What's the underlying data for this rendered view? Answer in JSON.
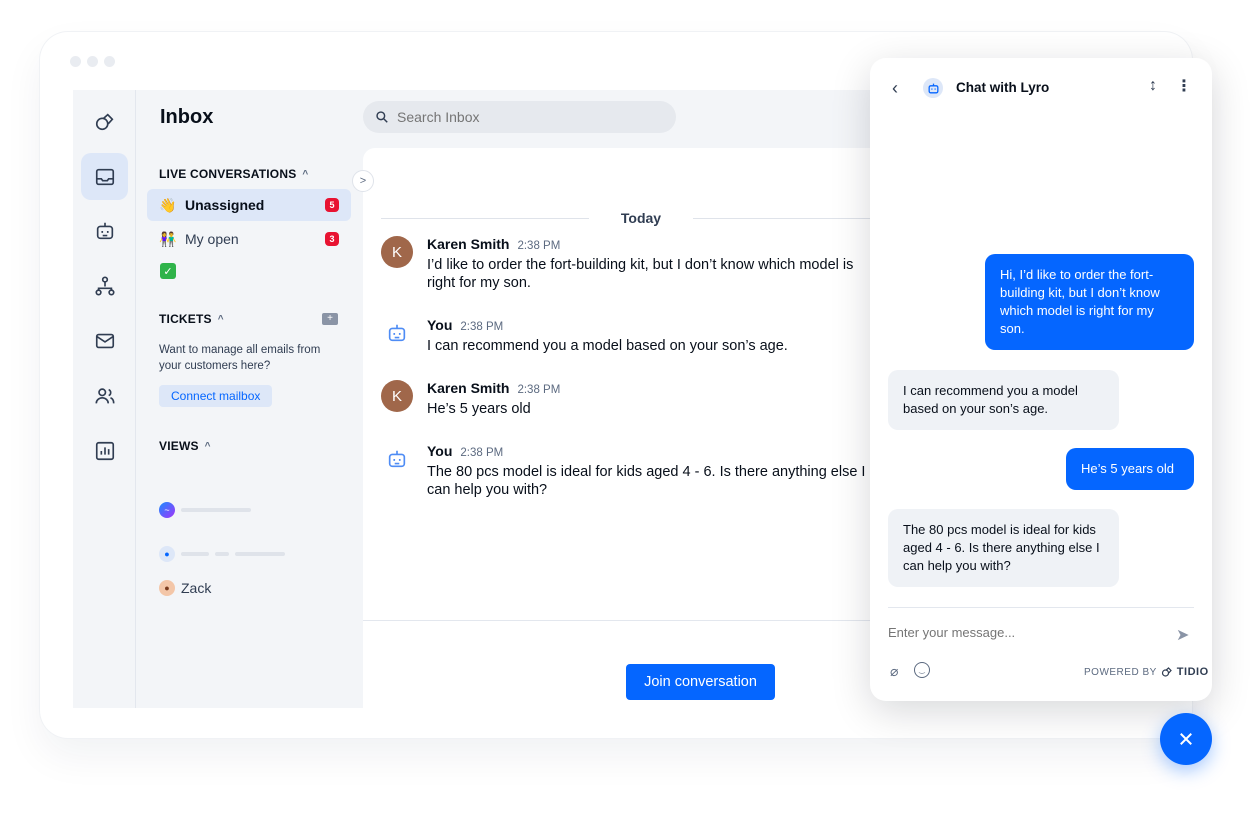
{
  "inbox": {
    "title": "Inbox",
    "search_placeholder": "Search Inbox",
    "live_conversations": {
      "heading": "LIVE CONVERSATIONS",
      "items": [
        {
          "emoji": "👋",
          "label": "Unassigned",
          "count": "5"
        },
        {
          "emoji": "👫",
          "label": "My open",
          "count": "3"
        }
      ],
      "extra_emoji": "✓"
    },
    "tickets": {
      "heading": "TICKETS",
      "description": "Want to manage all emails from your customers here?",
      "connect_label": "Connect mailbox"
    },
    "views": {
      "heading": "VIEWS",
      "named_view": "Zack"
    }
  },
  "conversation": {
    "day_label": "Today",
    "messages": [
      {
        "name": "Karen Smith",
        "initial": "K",
        "time": "2:38 PM",
        "text": "I’d like to order the fort-building kit, but I don’t know which model is right for my son."
      },
      {
        "name": "You",
        "time": "2:38 PM",
        "text": "I can recommend you a model based on your son’s age."
      },
      {
        "name": "Karen Smith",
        "initial": "K",
        "time": "2:38 PM",
        "text": "He’s 5 years old"
      },
      {
        "name": "You",
        "time": "2:38 PM",
        "text": "The 80 pcs model is ideal for kids aged 4 - 6. Is there anything else I can help you with?"
      }
    ],
    "join_label": "Join conversation"
  },
  "widget": {
    "title": "Chat with Lyro",
    "messages": [
      {
        "from": "visitor",
        "text": "Hi, I’d like to order the fort-building kit, but I don’t know which model is right for my son."
      },
      {
        "from": "bot",
        "text": "I can recommend you a model based on your son’s age."
      },
      {
        "from": "visitor",
        "text": "He’s 5 years old"
      },
      {
        "from": "bot",
        "text": "The 80 pcs model is ideal for kids aged 4 - 6. Is there anything else I can help you with?"
      }
    ],
    "input_placeholder": "Enter your message...",
    "powered_by": "POWERED BY",
    "brand": "TIDIO"
  },
  "colors": {
    "accent": "#0566ff",
    "badge": "#e81332",
    "avatar": "#a0674a",
    "panel_bg": "#f3f5f8"
  },
  "icons": [
    "projects-icon",
    "inbox-icon",
    "bot-icon",
    "flows-icon",
    "mail-icon",
    "contacts-icon",
    "analytics-icon"
  ]
}
